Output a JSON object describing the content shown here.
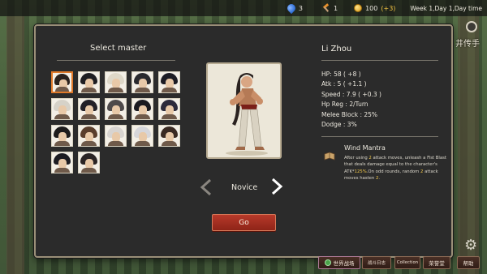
{
  "topbar": {
    "water": "3",
    "materials": "1",
    "coins": "100",
    "coins_plus": "(+3)",
    "date": "Week 1,Day 1,Day time"
  },
  "side": {
    "label": "井传手"
  },
  "panel": {
    "select_title": "Select master",
    "hero_name": "Li Zhou",
    "stats": [
      "HP: 58 ( +8 )",
      "Atk : 5 ( +1.1 )",
      "Speed : 7.9 ( +0.3 )",
      "Hp Reg : 2/Turn",
      "Melee Block : 25%",
      "Dodge : 3%"
    ],
    "skill": {
      "icon": "book-icon",
      "name": "Wind Mantra",
      "desc_1": "After using ",
      "desc_n1": "2",
      "desc_2": " attack moves, unleash a Fist Blast that deals damage equal to the character's ATK*",
      "desc_pct": "125%",
      "desc_3": ".On odd rounds, random ",
      "desc_n2": "2",
      "desc_4": " attack moves hasten ",
      "desc_n3": "2",
      "desc_5": "."
    },
    "rank": "Novice",
    "go_label": "Go",
    "prev_icon": "chevron-left-icon",
    "next_icon": "chevron-right-icon"
  },
  "portraits": [
    {
      "hair": "#2a221e",
      "selected": true
    },
    {
      "hair": "#1e1e22"
    },
    {
      "hair": "#ded8c8"
    },
    {
      "hair": "#2a2a2e"
    },
    {
      "hair": "#1c1c24"
    },
    {
      "hair": "#d6d2c8"
    },
    {
      "hair": "#222026"
    },
    {
      "hair": "#4e4a4a"
    },
    {
      "hair": "#1a1a20"
    },
    {
      "hair": "#2c2a3a"
    },
    {
      "hair": "#1e1c1c"
    },
    {
      "hair": "#5a3e2c"
    },
    {
      "hair": "#d8d4d0"
    },
    {
      "hair": "#d6d6da"
    },
    {
      "hair": "#3a2a22"
    },
    {
      "hair": "#1c1c22"
    },
    {
      "hair": "#2a2424"
    }
  ],
  "bottombar": {
    "world": "世界战场",
    "log": "战斗日志",
    "collection": "Collection",
    "hall": "荣誉堂",
    "help": "帮助"
  },
  "colors": {
    "accent_red": "#a8301f",
    "selected_border": "#e07a2a",
    "highlight_yellow": "#f2c94c"
  }
}
